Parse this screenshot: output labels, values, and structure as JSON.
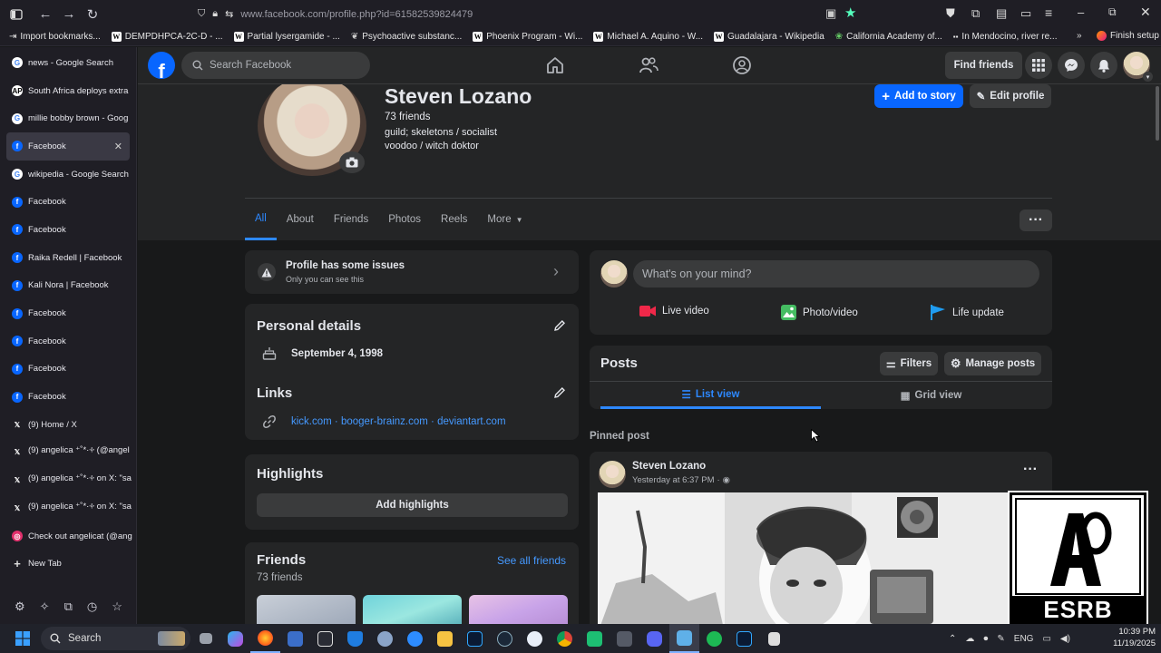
{
  "browser": {
    "url": "www.facebook.com/profile.php?id=61582539824479",
    "bookmarks": [
      {
        "label": "Import bookmarks...",
        "icon": "import-icon"
      },
      {
        "label": "DEMPDHPCA-2C-D - ...",
        "icon": "W"
      },
      {
        "label": "Partial lysergamide - ...",
        "icon": "W"
      },
      {
        "label": "Psychoactive substanc...",
        "icon": "leaf"
      },
      {
        "label": "Phoenix Program - Wi...",
        "icon": "W"
      },
      {
        "label": "Michael A. Aquino - W...",
        "icon": "W"
      },
      {
        "label": "Guadalajara - Wikipedia",
        "icon": "W"
      },
      {
        "label": "California Academy of...",
        "icon": "leaf"
      },
      {
        "label": "In Mendocino, river re...",
        "icon": "news"
      }
    ],
    "finish_setup": "Finish setup"
  },
  "tabs": [
    {
      "label": "news - Google Search",
      "icon": "google",
      "active": false
    },
    {
      "label": "South Africa deploys extra",
      "icon": "ap",
      "active": false
    },
    {
      "label": "millie bobby brown - Goog",
      "icon": "google",
      "active": false
    },
    {
      "label": "Facebook",
      "icon": "facebook",
      "active": true
    },
    {
      "label": "wikipedia - Google Search",
      "icon": "google",
      "active": false
    },
    {
      "label": "Facebook",
      "icon": "facebook",
      "active": false
    },
    {
      "label": "Facebook",
      "icon": "facebook",
      "active": false
    },
    {
      "label": "Raika Redell | Facebook",
      "icon": "facebook",
      "active": false
    },
    {
      "label": "Kali Nora | Facebook",
      "icon": "facebook",
      "active": false
    },
    {
      "label": "Facebook",
      "icon": "facebook",
      "active": false
    },
    {
      "label": "Facebook",
      "icon": "facebook",
      "active": false
    },
    {
      "label": "Facebook",
      "icon": "facebook",
      "active": false
    },
    {
      "label": "Facebook",
      "icon": "facebook",
      "active": false
    },
    {
      "label": "(9) Home / X",
      "icon": "x",
      "active": false
    },
    {
      "label": "(9) angelica ⁺˚*·༓ (@angel",
      "icon": "x",
      "active": false
    },
    {
      "label": "(9) angelica ⁺˚*·༓ on X: \"sa",
      "icon": "x",
      "active": false
    },
    {
      "label": "(9) angelica ⁺˚*·༓ on X: \"sa",
      "icon": "x",
      "active": false
    },
    {
      "label": "Check out angelicat (@ang",
      "icon": "instagram",
      "active": false
    }
  ],
  "new_tab": "New Tab",
  "fb": {
    "search_placeholder": "Search Facebook",
    "find_friends": "Find friends"
  },
  "profile": {
    "name": "Steven Lozano",
    "friends_count": "73 friends",
    "bio_line1": "guild; skeletons / socialist",
    "bio_line2": "voodoo / witch doktor",
    "add_to_story": "Add to story",
    "edit_profile": "Edit profile",
    "tabs": [
      "All",
      "About",
      "Friends",
      "Photos",
      "Reels",
      "More"
    ]
  },
  "issues": {
    "title": "Profile has some issues",
    "subtitle": "Only you can see this"
  },
  "personal": {
    "title": "Personal details",
    "birthday": "September 4, 1998",
    "links_title": "Links",
    "links": [
      "kick.com",
      "booger-brainz.com",
      "deviantart.com"
    ],
    "separator": " · "
  },
  "highlights": {
    "title": "Highlights",
    "add": "Add highlights"
  },
  "friends_card": {
    "title": "Friends",
    "see_all": "See all friends",
    "count": "73 friends"
  },
  "composer": {
    "placeholder": "What's on your mind?",
    "live": "Live video",
    "photo": "Photo/video",
    "life": "Life update"
  },
  "posts": {
    "title": "Posts",
    "filters": "Filters",
    "manage": "Manage posts",
    "list_view": "List view",
    "grid_view": "Grid view",
    "pinned": "Pinned post",
    "author": "Steven Lozano",
    "time": "Yesterday at 6:37 PM"
  },
  "esrb": {
    "label": "ESRB"
  },
  "taskbar": {
    "search": "Search",
    "lang": "ENG",
    "time": "10:39 PM",
    "date": "11/19/2025"
  },
  "colors": {
    "fb_blue": "#0866ff",
    "link_blue": "#4599ff",
    "card_bg": "#242526",
    "page_bg": "#18191a"
  }
}
